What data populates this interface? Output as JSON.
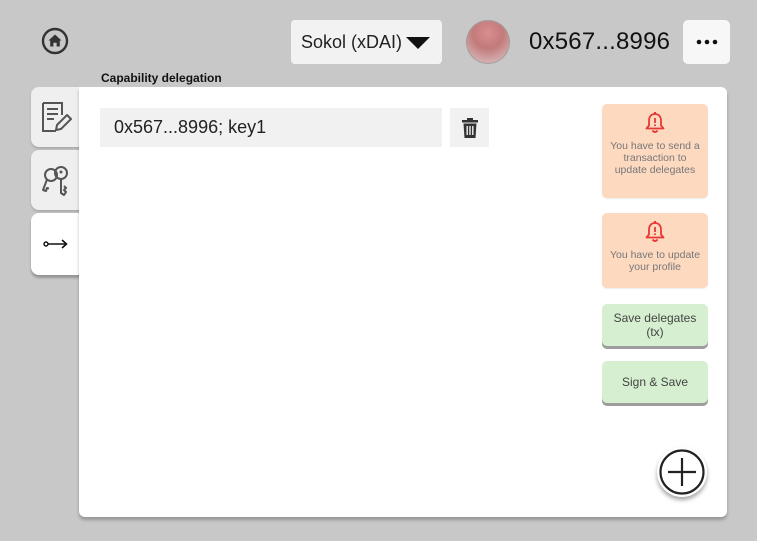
{
  "header": {
    "network": "Sokol (xDAI)",
    "address": "0x567...8996"
  },
  "section": {
    "title": "Capability delegation"
  },
  "delegates": [
    {
      "label": "0x567...8996; key1"
    }
  ],
  "notices": [
    {
      "text": "You have to send a transaction to update delegates"
    },
    {
      "text": "You have to update your profile"
    }
  ],
  "actions": {
    "save_delegates": "Save delegates (tx)",
    "sign_save": "Sign & Save"
  },
  "colors": {
    "background": "#c8c8c8",
    "notice": "#fdd9c0",
    "notice_icon": "#e53935",
    "action": "#d5efd0"
  }
}
